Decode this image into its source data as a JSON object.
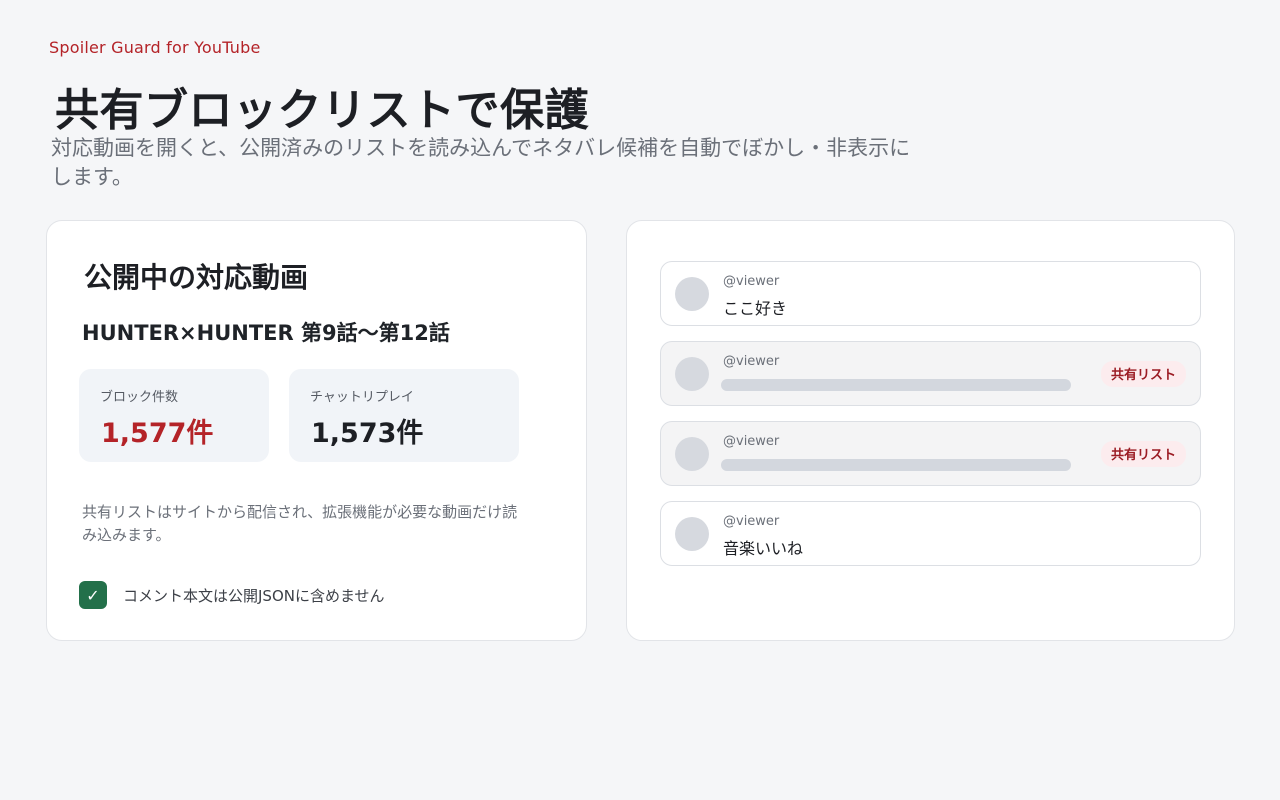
{
  "header": {
    "brand": "Spoiler Guard for YouTube",
    "headline": "共有ブロックリストで保護",
    "lead": "対応動画を開くと、公開済みのリストを読み込んでネタバレ候補を自動でぼかし・非表示にします。"
  },
  "video_panel": {
    "title": "公開中の対応動画",
    "video_title": "HUNTER×HUNTER 第9話〜第12話",
    "stats": [
      {
        "label": "ブロック件数",
        "value": "1,577件"
      },
      {
        "label": "チャットリプレイ",
        "value": "1,573件"
      }
    ],
    "note": "共有リストはサイトから配信され、拡張機能が必要な動画だけ読み込みます。",
    "checkbox": {
      "checked": true,
      "check_glyph": "✓",
      "label": "コメント本文は公開JSONに含めません"
    }
  },
  "comments_panel": {
    "comments": [
      {
        "author": "@viewer",
        "text": "ここ好き",
        "masked": false
      },
      {
        "author": "@viewer",
        "text": "",
        "masked": true,
        "badge": "共有リスト"
      },
      {
        "author": "@viewer",
        "text": "",
        "masked": true,
        "badge": "共有リスト"
      },
      {
        "author": "@viewer",
        "text": "音楽いいね",
        "masked": false
      }
    ]
  },
  "colors": {
    "accent": "#b42328",
    "check_green": "#23704a",
    "badge_bg": "#fcecee"
  }
}
